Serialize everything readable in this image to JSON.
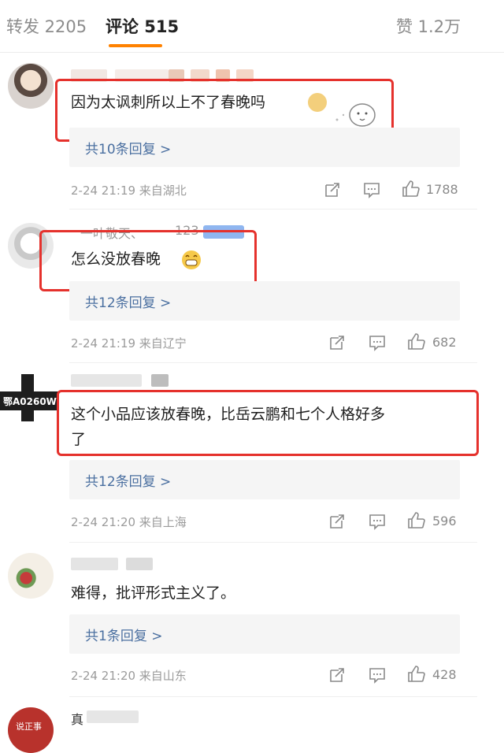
{
  "header": {
    "tabs": [
      {
        "label": "转发 2205"
      },
      {
        "label": "评论 515"
      },
      {
        "label": "赞 1.2万"
      }
    ],
    "active_tab": "评论 515",
    "accent_color": "#ff8200"
  },
  "comments": [
    {
      "text": "因为太讽刺所以上不了春晚吗",
      "emoji": "dog-emoji",
      "sticker": "sticker-icon",
      "replies_label": "共10条回复 >",
      "meta": "2-24 21:19  来自湖北",
      "likes": "1788"
    },
    {
      "name_fragment": "一叶敬天、",
      "name_number": "123",
      "text": "怎么没放春晚",
      "emoji": "grin-emoji",
      "replies_label": "共12条回复 >",
      "meta": "2-24 21:19  来自辽宁",
      "likes": "682"
    },
    {
      "avatar_text": "鄂A0260W",
      "text_line1": "这个小品应该放春晚，比岳云鹏和七个人格好多",
      "text_line2": "了",
      "replies_label": "共12条回复 >",
      "meta": "2-24 21:20  来自上海",
      "likes": "596"
    },
    {
      "text": "难得，批评形式主义了。",
      "replies_label": "共1条回复 >",
      "meta": "2-24 21:20  来自山东",
      "likes": "428"
    },
    {
      "avatar_text": "说正事",
      "name_fragment": "真"
    }
  ],
  "colors": {
    "highlight": "#e5312c",
    "reply_link": "#4a6fa0",
    "meta_text": "#9b9b9b"
  }
}
